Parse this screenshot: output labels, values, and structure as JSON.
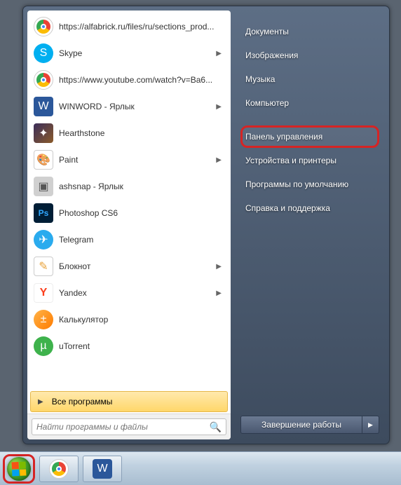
{
  "programs": [
    {
      "label": "https://alfabrick.ru/files/ru/sections_prod...",
      "icon": "chrome-icon",
      "hasSubmenu": false
    },
    {
      "label": "Skype",
      "icon": "skype-icon",
      "hasSubmenu": true
    },
    {
      "label": "https://www.youtube.com/watch?v=Ba6...",
      "icon": "chrome-icon",
      "hasSubmenu": false
    },
    {
      "label": "WINWORD - Ярлык",
      "icon": "word-icon",
      "hasSubmenu": true
    },
    {
      "label": "Hearthstone",
      "icon": "hearthstone-icon",
      "hasSubmenu": false
    },
    {
      "label": "Paint",
      "icon": "paint-icon",
      "hasSubmenu": true
    },
    {
      "label": "ashsnap - Ярлык",
      "icon": "ashsnap-icon",
      "hasSubmenu": false
    },
    {
      "label": "Photoshop CS6",
      "icon": "photoshop-icon",
      "hasSubmenu": false
    },
    {
      "label": "Telegram",
      "icon": "telegram-icon",
      "hasSubmenu": false
    },
    {
      "label": "Блокнот",
      "icon": "notepad-icon",
      "hasSubmenu": true
    },
    {
      "label": "Yandex",
      "icon": "yandex-icon",
      "hasSubmenu": true
    },
    {
      "label": "Калькулятор",
      "icon": "calculator-icon",
      "hasSubmenu": false
    },
    {
      "label": "uTorrent",
      "icon": "utorrent-icon",
      "hasSubmenu": false
    }
  ],
  "all_programs_label": "Все программы",
  "search": {
    "placeholder": "Найти программы и файлы"
  },
  "right_items": [
    {
      "label": "Документы",
      "highlighted": false
    },
    {
      "label": "Изображения",
      "highlighted": false
    },
    {
      "label": "Музыка",
      "highlighted": false
    },
    {
      "label": "Компьютер",
      "highlighted": false,
      "gap_after": true
    },
    {
      "label": "Панель управления",
      "highlighted": true
    },
    {
      "label": "Устройства и принтеры",
      "highlighted": false
    },
    {
      "label": "Программы по умолчанию",
      "highlighted": false
    },
    {
      "label": "Справка и поддержка",
      "highlighted": false
    }
  ],
  "shutdown": {
    "label": "Завершение работы"
  },
  "taskbar": {
    "items": [
      {
        "icon": "chrome-icon"
      },
      {
        "icon": "word-icon"
      }
    ]
  },
  "icon_glyphs": {
    "skype-icon": "S",
    "word-icon": "W",
    "paint-icon": "🎨",
    "ashsnap-icon": "▣",
    "photoshop-icon": "Ps",
    "telegram-icon": "✈",
    "notepad-icon": "✎",
    "yandex-icon": "Y",
    "calculator-icon": "±",
    "utorrent-icon": "µ",
    "hearthstone-icon": "✦"
  },
  "icon_classes": {
    "chrome-icon": "ic-chrome",
    "skype-icon": "ic-skype",
    "word-icon": "ic-word",
    "hearthstone-icon": "ic-hearth",
    "paint-icon": "ic-paint",
    "ashsnap-icon": "ic-ashsnap",
    "photoshop-icon": "ic-ps",
    "telegram-icon": "ic-telegram",
    "notepad-icon": "ic-notepad",
    "yandex-icon": "ic-yandex",
    "calculator-icon": "ic-calc",
    "utorrent-icon": "ic-utorrent"
  }
}
